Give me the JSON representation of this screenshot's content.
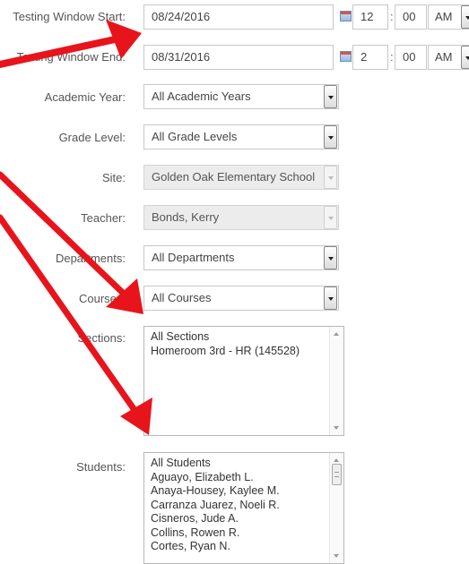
{
  "form": {
    "window_start": {
      "label": "Testing Window Start:",
      "date": "08/24/2016",
      "hour": "12",
      "minute": "00",
      "ampm": "AM"
    },
    "window_end": {
      "label": "Testing Window End:",
      "date": "08/31/2016",
      "hour": "2",
      "minute": "00",
      "ampm": "AM"
    },
    "academic_year": {
      "label": "Academic Year:",
      "value": "All Academic Years"
    },
    "grade_level": {
      "label": "Grade Level:",
      "value": "All Grade Levels"
    },
    "site": {
      "label": "Site:",
      "value": "Golden Oak Elementary School"
    },
    "teacher": {
      "label": "Teacher:",
      "value": "Bonds, Kerry"
    },
    "departments": {
      "label": "Departments:",
      "value": "All Departments"
    },
    "courses": {
      "label": "Courses:",
      "value": "All Courses"
    },
    "sections": {
      "label": "Sections:",
      "options": [
        "All Sections",
        "Homeroom 3rd - HR (145528)"
      ]
    },
    "students": {
      "label": "Students:",
      "options": [
        "All Students",
        "Aguayo, Elizabeth L.",
        "Anaya-Housey, Kaylee M.",
        "Carranza Juarez, Noeli R.",
        "Cisneros, Jude A.",
        "Collins, Rowen R.",
        "Cortes, Ryan N."
      ]
    }
  },
  "annotation": {
    "arrow_color": "#e8141b"
  }
}
